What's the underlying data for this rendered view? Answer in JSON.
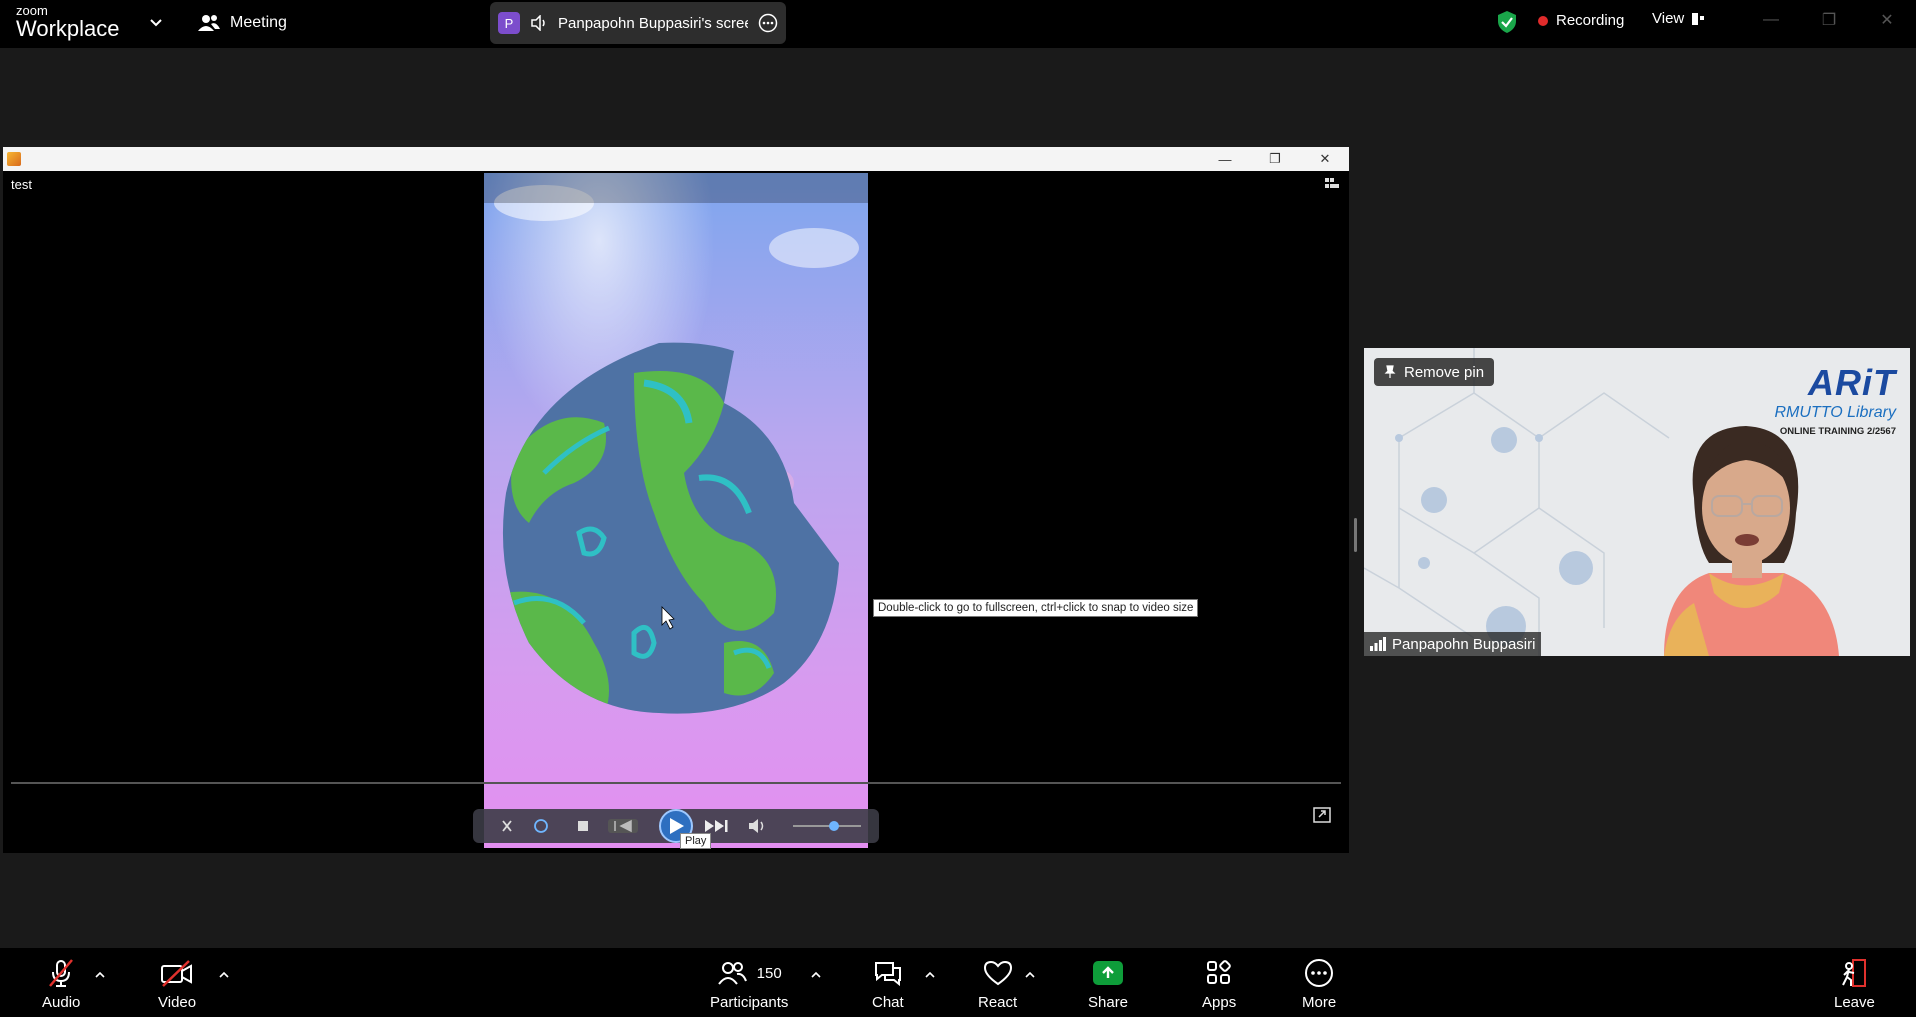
{
  "header": {
    "logo_small": "zoom",
    "logo_big": "Workplace",
    "meeting_label": "Meeting",
    "share_pill": {
      "badge": "P",
      "text": "Panpapohn Buppasiri's scree"
    },
    "recording_label": "Recording",
    "view_label": "View"
  },
  "player": {
    "file_label": "test",
    "tooltip": "Double-click to go to fullscreen, ctrl+click to snap to video size",
    "play_tooltip": "Play",
    "volume_level": 0.6
  },
  "participant": {
    "remove_pin_label": "Remove pin",
    "name": "Panpapohn Buppasiri",
    "brand_logo": "ARiT",
    "brand_line": "RMUTTO Library",
    "brand_sub": "ONLINE TRAINING 2/2567"
  },
  "toolbar": {
    "audio_label": "Audio",
    "video_label": "Video",
    "participants_label": "Participants",
    "participants_count": "150",
    "chat_label": "Chat",
    "react_label": "React",
    "share_label": "Share",
    "apps_label": "Apps",
    "more_label": "More",
    "leave_label": "Leave"
  },
  "colors": {
    "share_green": "#0e9d3a",
    "record_red": "#e02b2b",
    "mute_red": "#e0312d",
    "badge_purple": "#7c4dcc"
  }
}
